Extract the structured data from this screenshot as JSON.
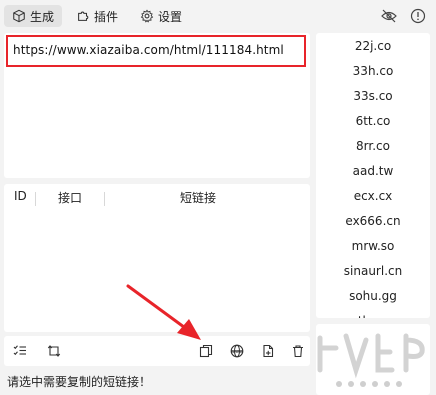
{
  "tabs": [
    {
      "label": "生成",
      "icon": "cube-icon",
      "active": true
    },
    {
      "label": "插件",
      "icon": "puzzle-icon",
      "active": false
    },
    {
      "label": "设置",
      "icon": "gear-icon",
      "active": false
    }
  ],
  "header_icons": [
    "eye-off-icon",
    "help-circle-icon"
  ],
  "url_input": {
    "value": "https://www.xiazaiba.com/html/111184.html",
    "highlight_color": "#e8242a"
  },
  "table": {
    "columns": [
      "ID",
      "接口",
      "短链接"
    ],
    "rows": []
  },
  "services": [
    "22j.co",
    "33h.co",
    "33s.co",
    "6tt.co",
    "8rr.co",
    "aad.tw",
    "ecx.cx",
    "ex666.cn",
    "mrw.so",
    "sinaurl.cn",
    "sohu.gg"
  ],
  "services_next_partial": "tb.cn",
  "toolbar_icons": [
    "checklist-icon",
    "swap-icon",
    "copy-icon",
    "globe-icon",
    "export-icon",
    "delete-icon"
  ],
  "status_text": "请选中需要复制的短链接！",
  "annotation_arrow": {
    "color": "#e8242a"
  }
}
